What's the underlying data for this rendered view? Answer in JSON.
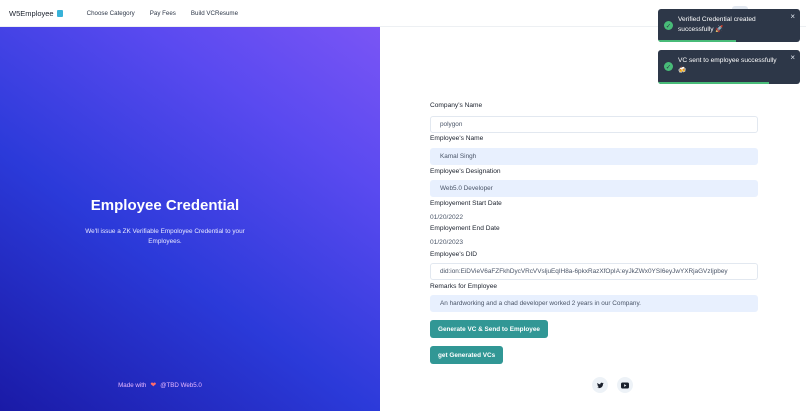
{
  "navbar": {
    "brand": "W5Employee",
    "links": [
      "Choose Category",
      "Pay Fees",
      "Build VCResume"
    ]
  },
  "hero": {
    "title": "Employee Credential",
    "subtitle": "We'll issue a ZK Verifiable Empoloyee Credential to your Employees.",
    "footer_prefix": "Made with",
    "footer_suffix": "@TBD Web5.0"
  },
  "form": {
    "company_label": "Company's Name",
    "company_value": "polygon",
    "employee_label": "Employee's Name",
    "employee_value": "Kamal Singh",
    "designation_label": "Employee's Designation",
    "designation_value": "Web5.0 Developer",
    "start_label": "Employement Start Date",
    "start_value": "01/20/2022",
    "end_label": "Employement End Date",
    "end_value": "01/20/2023",
    "did_label": "Employee's DID",
    "did_value": "did:ion:EiDVieV6aFZFkhDycVRcVVsljuEqIH8a-6pkxRazXfOpIA:eyJkZWx0YSI6eyJwYXRjaGVzIjpbey",
    "remarks_label": "Remarks for Employee",
    "remarks_value": "An hardworking and a chad developer worked 2 years in our Company.",
    "generate_button": "Generate VC & Send to Employee",
    "get_button": "get Generated VCs"
  },
  "toasts": [
    {
      "message": "Verified Credential created successfully 🚀",
      "progress": 0.55
    },
    {
      "message": "VC sent to employee successfully 🍻",
      "progress": 0.78
    }
  ],
  "colors": {
    "primary_button": "#319795",
    "toast_bg": "#2d3748",
    "toast_success": "#48bb78",
    "filled_input": "#e8f0fe"
  },
  "icons": [
    "twitter-icon",
    "youtube-icon",
    "heart-icon",
    "check-icon",
    "close-icon"
  ]
}
